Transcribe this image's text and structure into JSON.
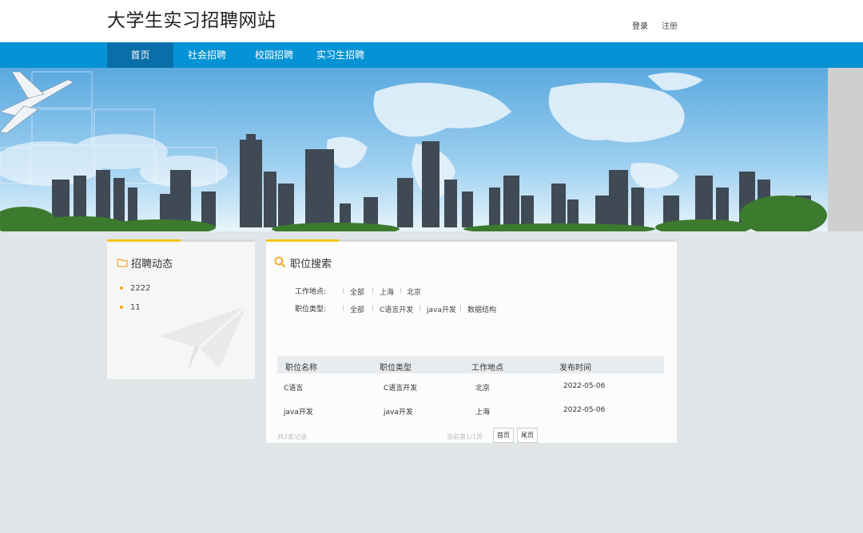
{
  "header": {
    "site_title": "大学生实习招聘网站",
    "login": "登录",
    "register": "注册"
  },
  "nav": {
    "items": [
      "首页",
      "社会招聘",
      "校园招聘",
      "实习生招聘"
    ]
  },
  "news_panel": {
    "title": "招聘动态",
    "items": [
      "2222",
      "11"
    ]
  },
  "search_panel": {
    "title": "职位搜索",
    "location_label": "工作地点:",
    "location_options": [
      "全部",
      "上海",
      "北京"
    ],
    "type_label": "职位类型:",
    "type_options": [
      "全部",
      "C语言开发",
      "java开发",
      "数据结构"
    ],
    "columns": [
      "职位名称",
      "职位类型",
      "工作地点",
      "发布时间"
    ],
    "rows": [
      [
        "C语言",
        "C语言开发",
        "北京",
        "2022-05-06"
      ],
      [
        "java开发",
        "java开发",
        "上海",
        "2022-05-06"
      ]
    ],
    "total_records": "共2条记录",
    "page_info": "当前第1/1页",
    "first_page": "首页",
    "last_page": "尾页"
  },
  "colors": {
    "nav_bg": "#0593d5",
    "nav_active": "#0a6fa8",
    "accent": "#f5c518",
    "page_bg": "#e1e5e8"
  }
}
